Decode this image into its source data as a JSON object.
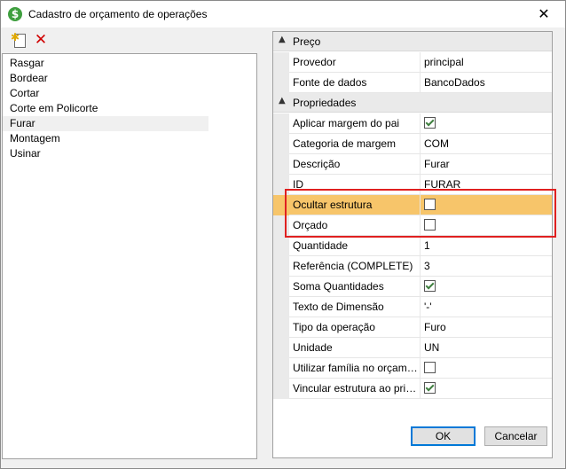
{
  "window": {
    "title": "Cadastro de orçamento de operações",
    "app_icon": "dollar-icon",
    "close_glyph": "✕"
  },
  "toolbar": {
    "new_icon": "new-document-icon",
    "delete_glyph": "✕"
  },
  "operations": [
    {
      "label": "Rasgar"
    },
    {
      "label": "Bordear"
    },
    {
      "label": "Cortar"
    },
    {
      "label": "Corte em Policorte"
    },
    {
      "label": "Furar",
      "selected": true
    },
    {
      "label": "Montagem"
    },
    {
      "label": "Usinar"
    }
  ],
  "grid": {
    "categories": [
      {
        "label": "Preço",
        "toggle": "▲",
        "props": [
          {
            "name": "Provedor",
            "value": "principal"
          },
          {
            "name": "Fonte de dados",
            "value": "BancoDados"
          }
        ]
      },
      {
        "label": "Propriedades",
        "toggle": "▲",
        "props": [
          {
            "name": "Aplicar margem do pai",
            "check": true
          },
          {
            "name": "Categoria de margem",
            "value": "COM"
          },
          {
            "name": "Descrição",
            "value": "Furar"
          },
          {
            "name": "ID",
            "value": "FURAR"
          },
          {
            "name": "Ocultar estrutura",
            "check": false,
            "highlight": true
          },
          {
            "name": "Orçado",
            "check": false
          },
          {
            "name": "Quantidade",
            "value": "1"
          },
          {
            "name": "Referência (COMPLETE)",
            "value": "3"
          },
          {
            "name": "Soma Quantidades",
            "check": true
          },
          {
            "name": "Texto de Dimensão",
            "value": "'-'"
          },
          {
            "name": "Tipo da operação",
            "value": "Furo"
          },
          {
            "name": "Unidade",
            "value": "UN"
          },
          {
            "name": "Utilizar família no orçamen...",
            "check": false
          },
          {
            "name": "Vincular estrutura ao prim...",
            "check": true
          }
        ]
      }
    ]
  },
  "buttons": {
    "ok": "OK",
    "cancel": "Cancelar"
  },
  "colors": {
    "highlight_row": "#f7c56a",
    "annotation_box": "#e02020",
    "check_mark": "#3f7f3f",
    "delete_icon": "#d00000"
  }
}
